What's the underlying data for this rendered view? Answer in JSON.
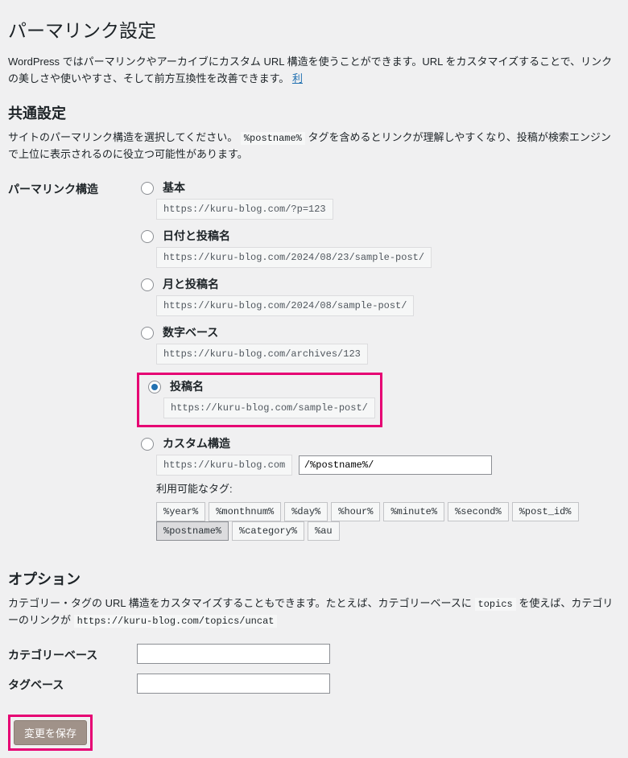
{
  "page": {
    "title": "パーマリンク設定",
    "intro_a": "WordPress ではパーマリンクやアーカイブにカスタム URL 構造を使うことができます。URL をカスタマイズすることで、リンクの美しさや使いやすさ、そして前方互換性を改善できます。",
    "intro_link": "利"
  },
  "common": {
    "heading": "共通設定",
    "desc_a": "サイトのパーマリンク構造を選択してください。",
    "desc_tag": "%postname%",
    "desc_b": "タグを含めるとリンクが理解しやすくなり、投稿が検索エンジンで上位に表示されるのに役立つ可能性があります。"
  },
  "structure": {
    "label": "パーマリンク構造",
    "options": [
      {
        "label": "基本",
        "sample": "https://kuru-blog.com/?p=123"
      },
      {
        "label": "日付と投稿名",
        "sample": "https://kuru-blog.com/2024/08/23/sample-post/"
      },
      {
        "label": "月と投稿名",
        "sample": "https://kuru-blog.com/2024/08/sample-post/"
      },
      {
        "label": "数字ベース",
        "sample": "https://kuru-blog.com/archives/123"
      },
      {
        "label": "投稿名",
        "sample": "https://kuru-blog.com/sample-post/"
      },
      {
        "label": "カスタム構造",
        "base": "https://kuru-blog.com",
        "value": "/%postname%/"
      }
    ],
    "selected_index": 4,
    "available_tags_label": "利用可能なタグ:",
    "tags": [
      "%year%",
      "%monthnum%",
      "%day%",
      "%hour%",
      "%minute%",
      "%second%",
      "%post_id%",
      "%postname%",
      "%category%",
      "%au"
    ],
    "active_tag": "%postname%"
  },
  "options": {
    "heading": "オプション",
    "desc_a": "カテゴリー・タグの URL 構造をカスタマイズすることもできます。たとえば、カテゴリーベースに",
    "desc_code1": "topics",
    "desc_b": "を使えば、カテゴリーのリンクが",
    "desc_code2": "https://kuru-blog.com/topics/uncat",
    "category_base_label": "カテゴリーベース",
    "tag_base_label": "タグベース",
    "category_base_value": "",
    "tag_base_value": ""
  },
  "submit": {
    "label": "変更を保存"
  }
}
